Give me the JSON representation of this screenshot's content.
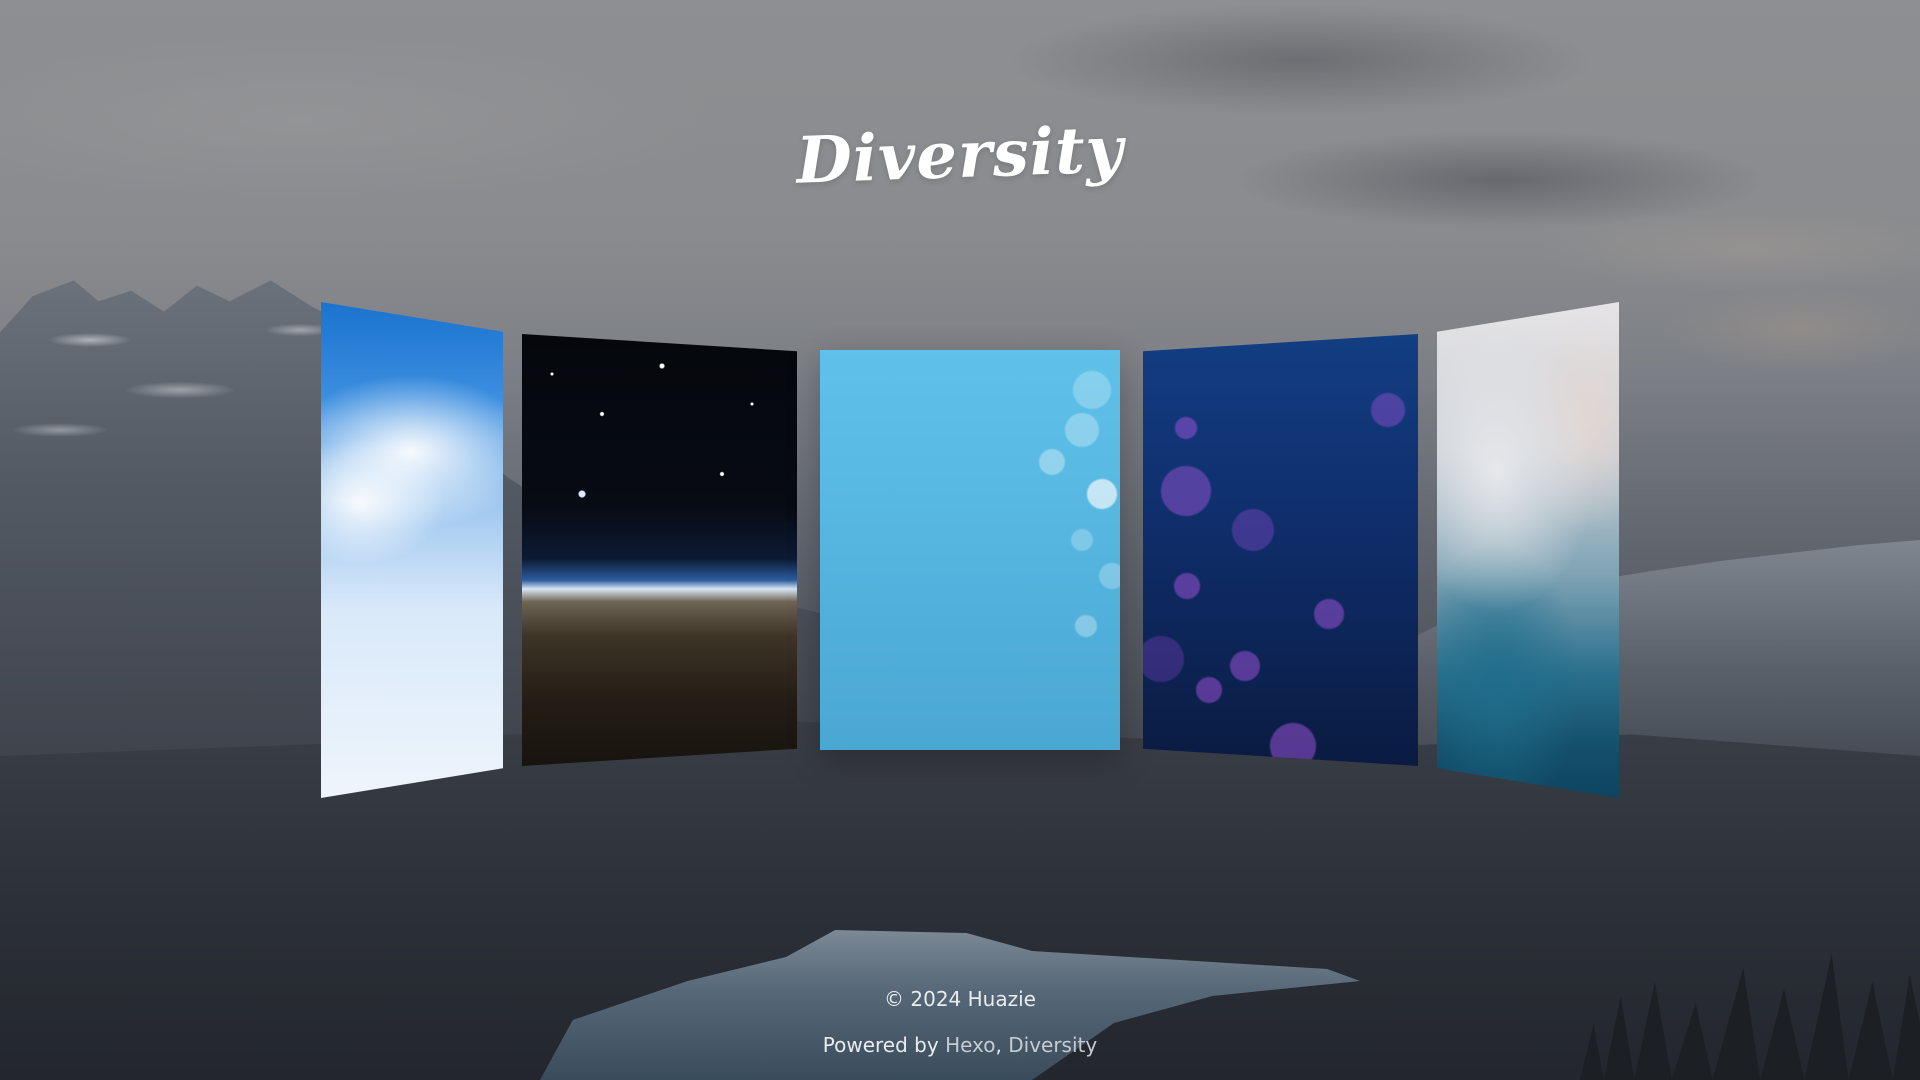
{
  "site": {
    "title": "Diversity"
  },
  "carousel": {
    "cards": [
      {
        "theme": "sky-clouds"
      },
      {
        "theme": "space-earth-horizon"
      },
      {
        "theme": "light-blue-bokeh"
      },
      {
        "theme": "deep-blue-bubbles"
      },
      {
        "theme": "misty-teal-watercolor"
      }
    ]
  },
  "footer": {
    "copyright": "© 2024 Huazie",
    "powered_prefix": "Powered by ",
    "link_hexo": "Hexo",
    "separator": ", ",
    "link_diversity": "Diversity"
  },
  "colors": {
    "title": "#ffffff",
    "footer_text": "#e9ebee",
    "footer_link": "#c6cbd2"
  }
}
